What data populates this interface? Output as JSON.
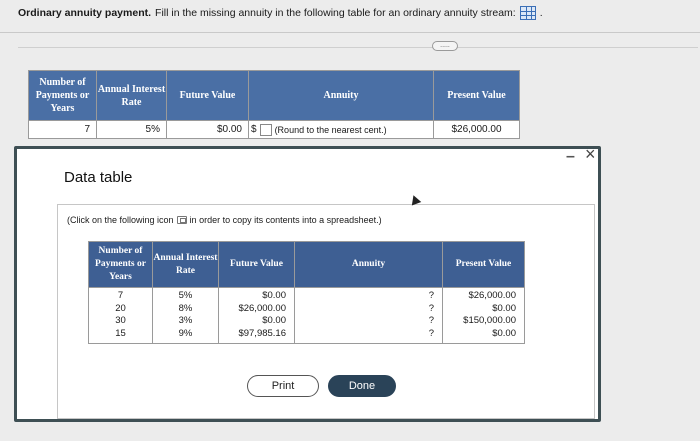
{
  "question": {
    "bold_label": "Ordinary annuity payment.",
    "text": "Fill in the missing annuity in the following table for an ordinary annuity stream:",
    "grid_icon": "table-grid-icon",
    "more_label": "....."
  },
  "main_table": {
    "headers": [
      "Number of Payments or Years",
      "Annual Interest Rate",
      "Future Value",
      "Annuity",
      "Present Value"
    ],
    "row": {
      "years": "7",
      "rate": "5%",
      "future_value": "$0.00",
      "annuity_prefix": "$",
      "annuity_hint": "(Round to the nearest cent.)",
      "present_value": "$26,000.00"
    }
  },
  "modal": {
    "title": "Data table",
    "minimize": "–",
    "close": "×",
    "instruction_pre": "(Click on the following icon",
    "instruction_post": "in order to copy its contents into a spreadsheet.)",
    "headers": [
      "Number of Payments or Years",
      "Annual Interest Rate",
      "Future Value",
      "Annuity",
      "Present Value"
    ],
    "years": [
      "7",
      "20",
      "30",
      "15"
    ],
    "rates": [
      "5%",
      "8%",
      "3%",
      "9%"
    ],
    "future_values": [
      "$0.00",
      "$26,000.00",
      "$0.00",
      "$97,985.16"
    ],
    "annuities": [
      "?",
      "?",
      "?",
      "?"
    ],
    "present_values": [
      "$26,000.00",
      "$0.00",
      "$150,000.00",
      "$0.00"
    ],
    "print_label": "Print",
    "done_label": "Done"
  },
  "colors": {
    "header_bg": "#4a6fa5",
    "done_bg": "#2a4358"
  }
}
